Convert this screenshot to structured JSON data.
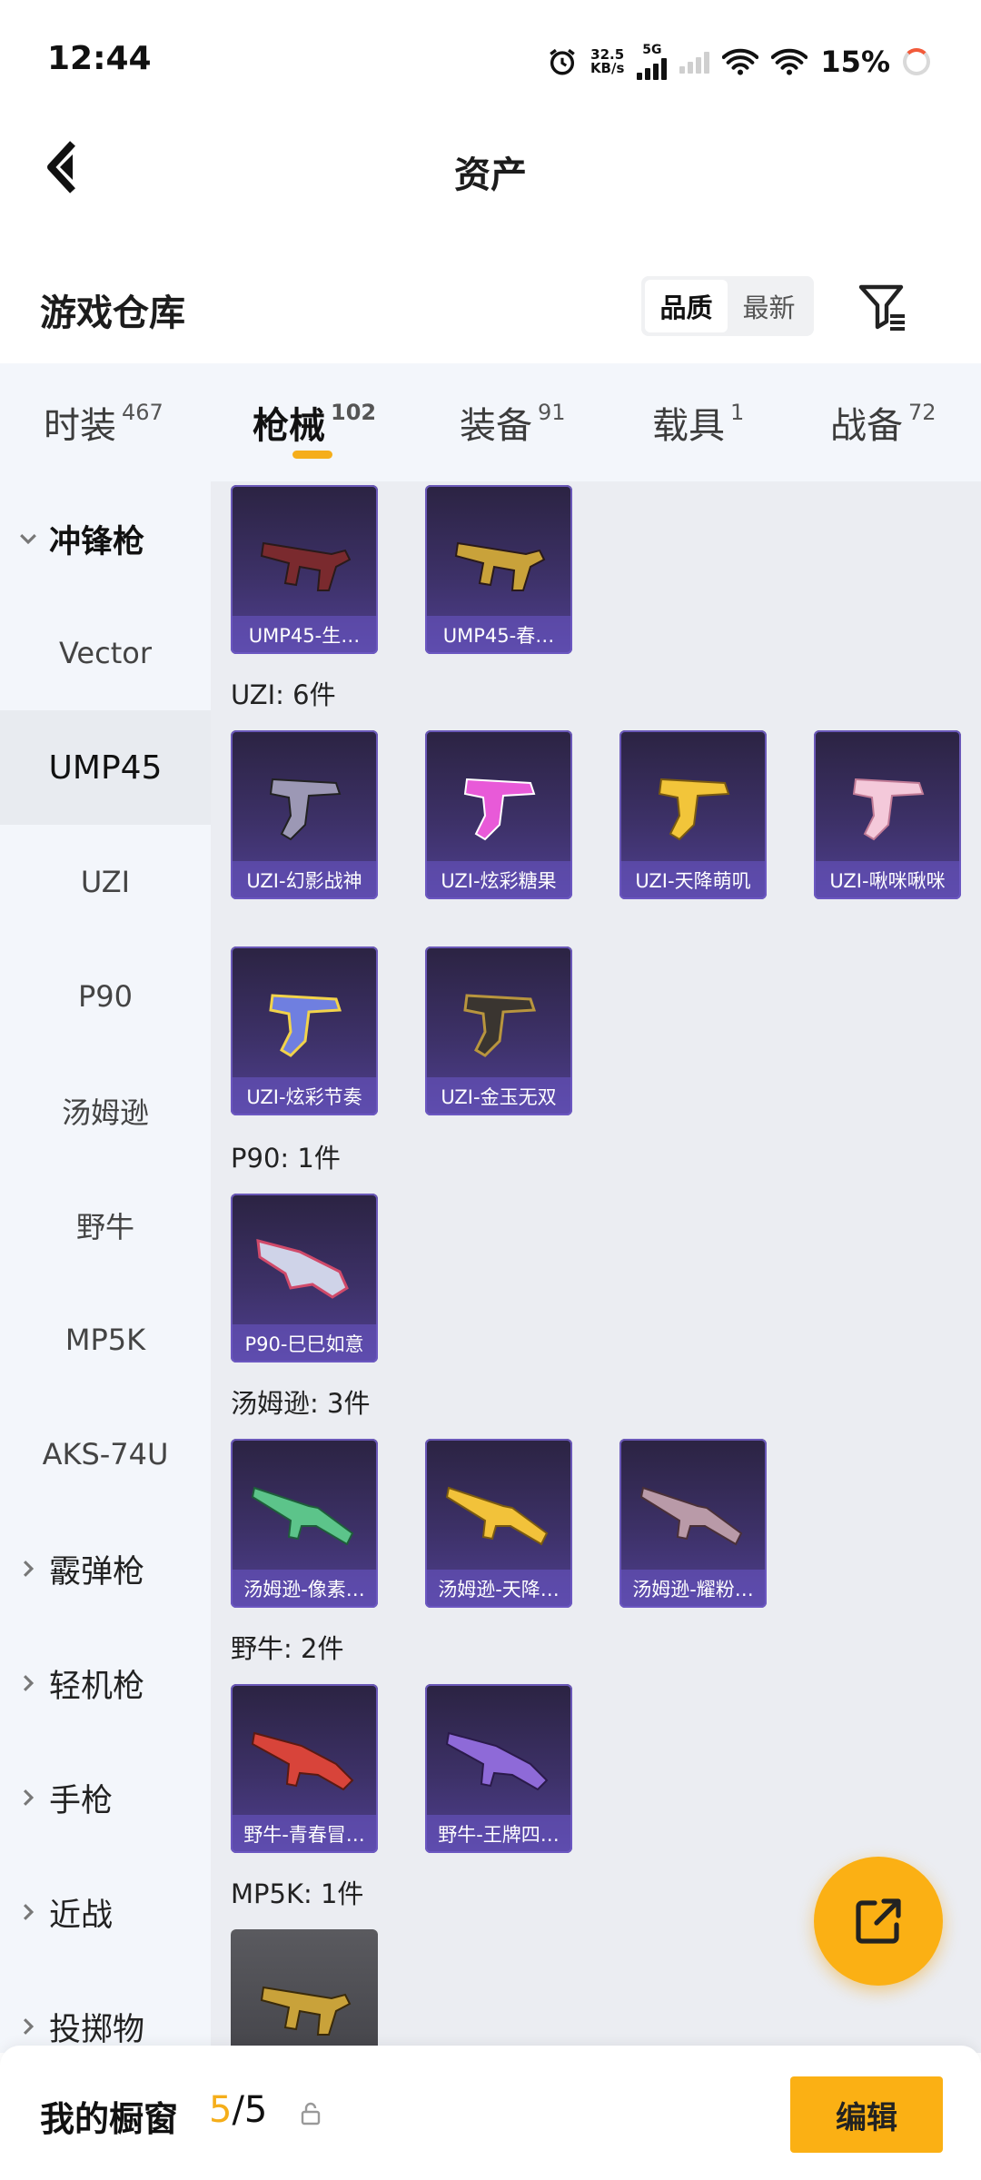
{
  "status_bar": {
    "time": "12:44",
    "speed_value": "32.5",
    "speed_unit": "KB/s",
    "network": "5G",
    "battery": "15%"
  },
  "header": {
    "title": "资产"
  },
  "warehouse": {
    "title": "游戏仓库",
    "sort_options": [
      "品质",
      "最新"
    ],
    "sort_selected": "品质"
  },
  "tabs": [
    {
      "label": "时装",
      "count": "467"
    },
    {
      "label": "枪械",
      "count": "102",
      "active": true
    },
    {
      "label": "装备",
      "count": "91"
    },
    {
      "label": "载具",
      "count": "1"
    },
    {
      "label": "战备",
      "count": "72"
    }
  ],
  "sidebar": {
    "items": [
      {
        "label": "冲锋枪",
        "type": "group",
        "expanded": true
      },
      {
        "label": "Vector",
        "type": "sub"
      },
      {
        "label": "UMP45",
        "type": "sub",
        "selected": true
      },
      {
        "label": "UZI",
        "type": "sub"
      },
      {
        "label": "P90",
        "type": "sub"
      },
      {
        "label": "汤姆逊",
        "type": "sub"
      },
      {
        "label": "野牛",
        "type": "sub"
      },
      {
        "label": "MP5K",
        "type": "sub"
      },
      {
        "label": "AKS-74U",
        "type": "sub"
      },
      {
        "label": "霰弹枪",
        "type": "group"
      },
      {
        "label": "轻机枪",
        "type": "group"
      },
      {
        "label": "手枪",
        "type": "group"
      },
      {
        "label": "近战",
        "type": "group"
      },
      {
        "label": "投掷物",
        "type": "group"
      }
    ]
  },
  "content": {
    "ump45_items": [
      "UMP45-生…",
      "UMP45-春…"
    ],
    "uzi_header": "UZI: 6件",
    "uzi_items": [
      "UZI-幻影战神",
      "UZI-炫彩糖果",
      "UZI-天降萌叽",
      "UZI-啾咪啾咪",
      "UZI-炫彩节奏",
      "UZI-金玉无双"
    ],
    "p90_header": "P90: 1件",
    "p90_items": [
      "P90-巳巳如意"
    ],
    "thompson_header": "汤姆逊: 3件",
    "thompson_items": [
      "汤姆逊-像素…",
      "汤姆逊-天降…",
      "汤姆逊-耀粉…"
    ],
    "bizon_header": "野牛: 2件",
    "bizon_items": [
      "野牛-青春冒…",
      "野牛-王牌四…"
    ],
    "mp5k_header": "MP5K: 1件"
  },
  "bottom": {
    "title": "我的橱窗",
    "count_current": "5",
    "count_total": "/5",
    "edit_label": "编辑"
  },
  "colors": {
    "accent": "#fbb014",
    "card_bg": "#3d3168",
    "card_border": "#6a58b8",
    "sidebar_bg": "#f3f6fb",
    "content_bg": "#ebedf2"
  }
}
